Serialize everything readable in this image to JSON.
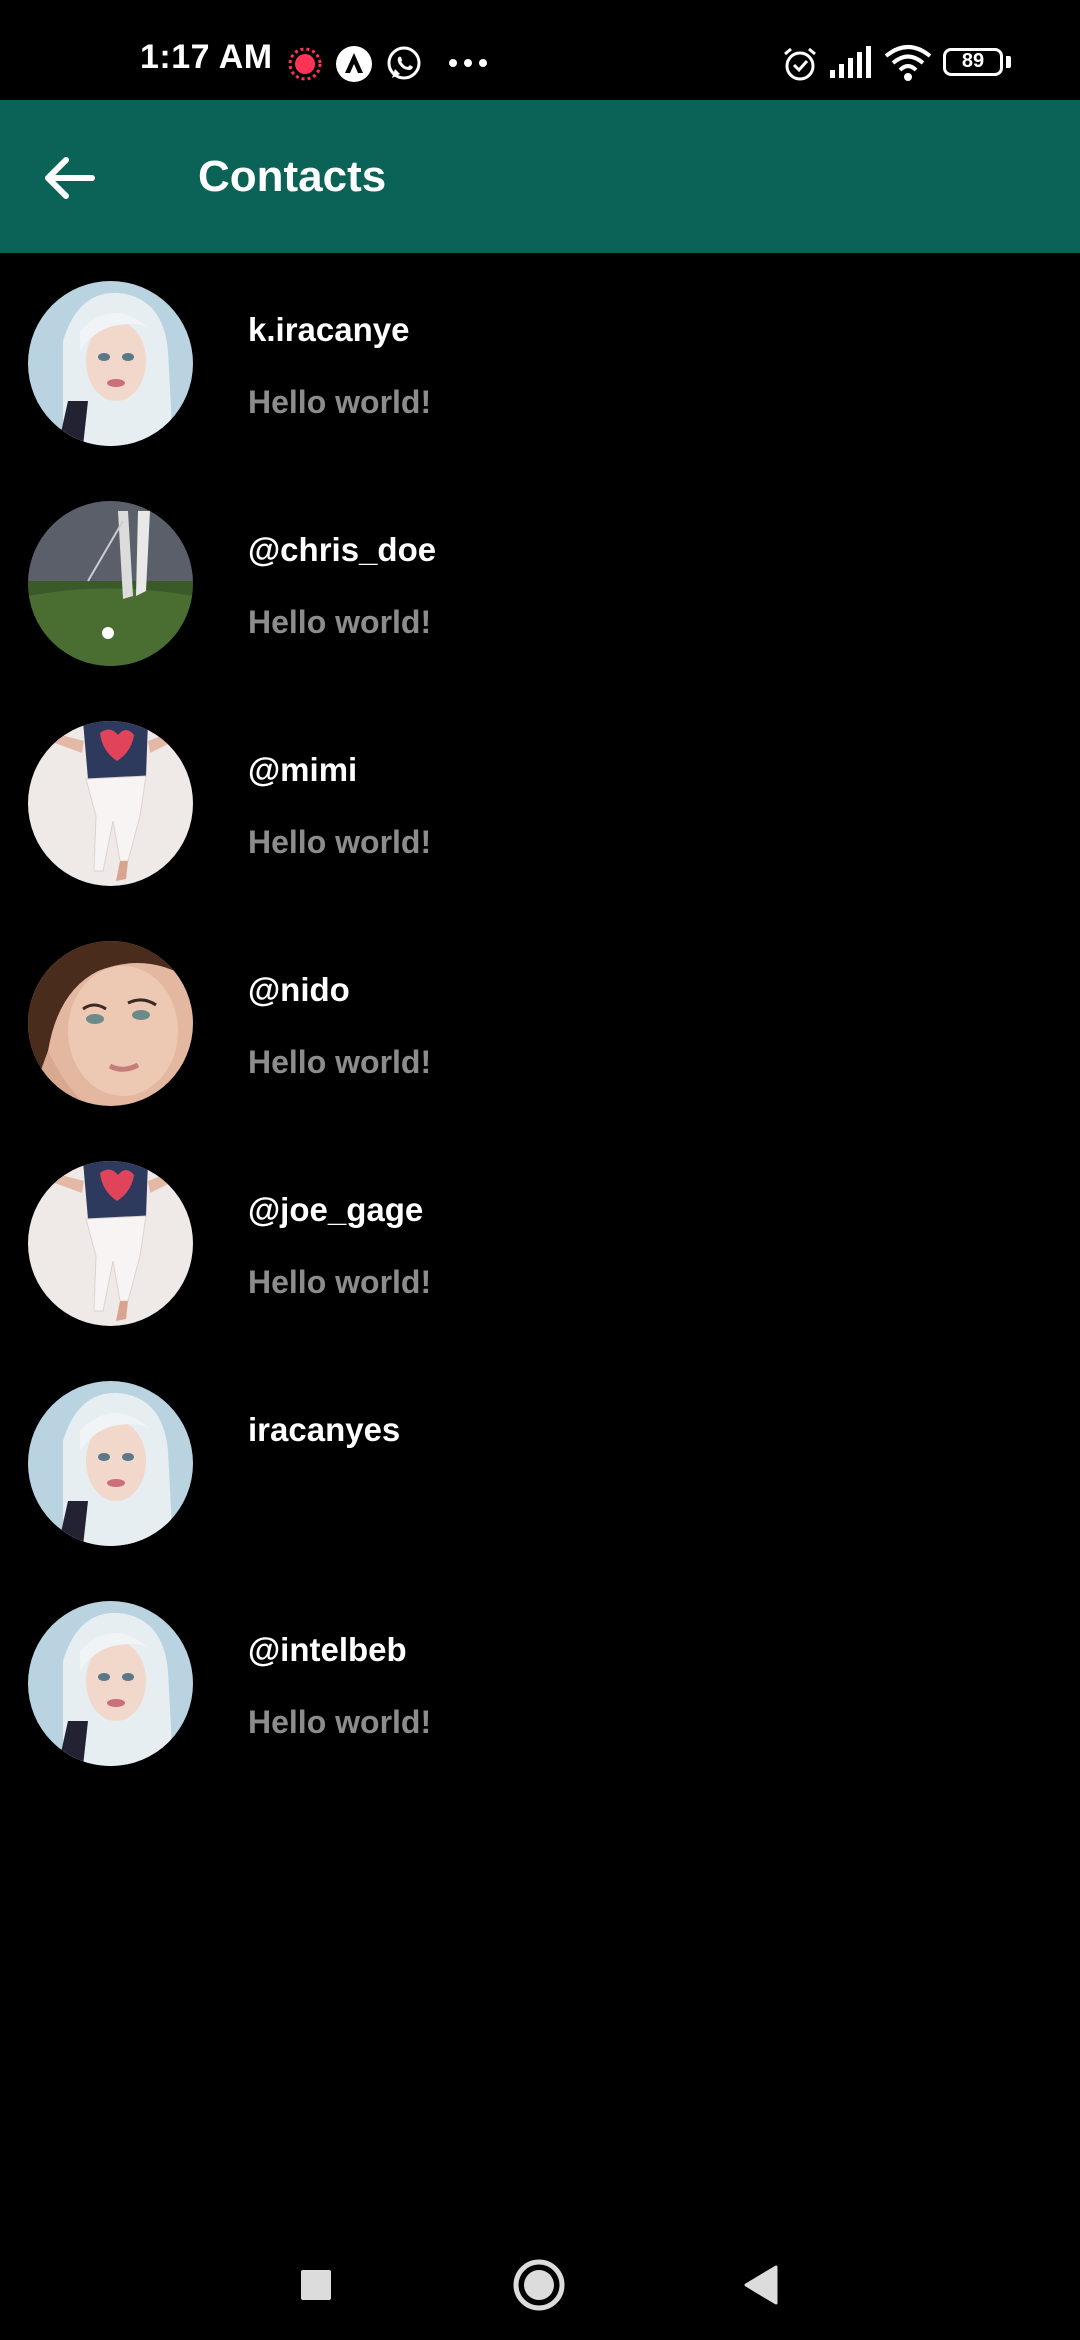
{
  "status_bar": {
    "time": "1:17 AM",
    "battery": "89",
    "icons": [
      "recording-icon",
      "app-notification-icon",
      "whatsapp-icon",
      "more-notifications-icon",
      "alarm-icon",
      "signal-icon",
      "wifi-icon",
      "battery-icon"
    ]
  },
  "app_bar": {
    "title": "Contacts",
    "color": "#0b6256",
    "back_icon": "arrow-back-icon"
  },
  "contacts": [
    {
      "name": "k.iracanye",
      "message": "Hello world!",
      "avatar": "avatar-blonde"
    },
    {
      "name": "@chris_doe",
      "message": "Hello world!",
      "avatar": "avatar-golf"
    },
    {
      "name": "@mimi",
      "message": "Hello world!",
      "avatar": "avatar-dancer"
    },
    {
      "name": "@nido",
      "message": "Hello world!",
      "avatar": "avatar-portrait"
    },
    {
      "name": "@joe_gage",
      "message": "Hello world!",
      "avatar": "avatar-dancer"
    },
    {
      "name": "iracanyes",
      "message": "",
      "avatar": "avatar-blonde"
    },
    {
      "name": "@intelbeb",
      "message": "Hello world!",
      "avatar": "avatar-blonde"
    }
  ],
  "colors": {
    "background": "#000000",
    "name_text": "#ffffff",
    "message_text": "#8c8c8c"
  },
  "nav_bar": {
    "buttons": [
      "recents-square-icon",
      "home-circle-icon",
      "back-triangle-icon"
    ]
  }
}
